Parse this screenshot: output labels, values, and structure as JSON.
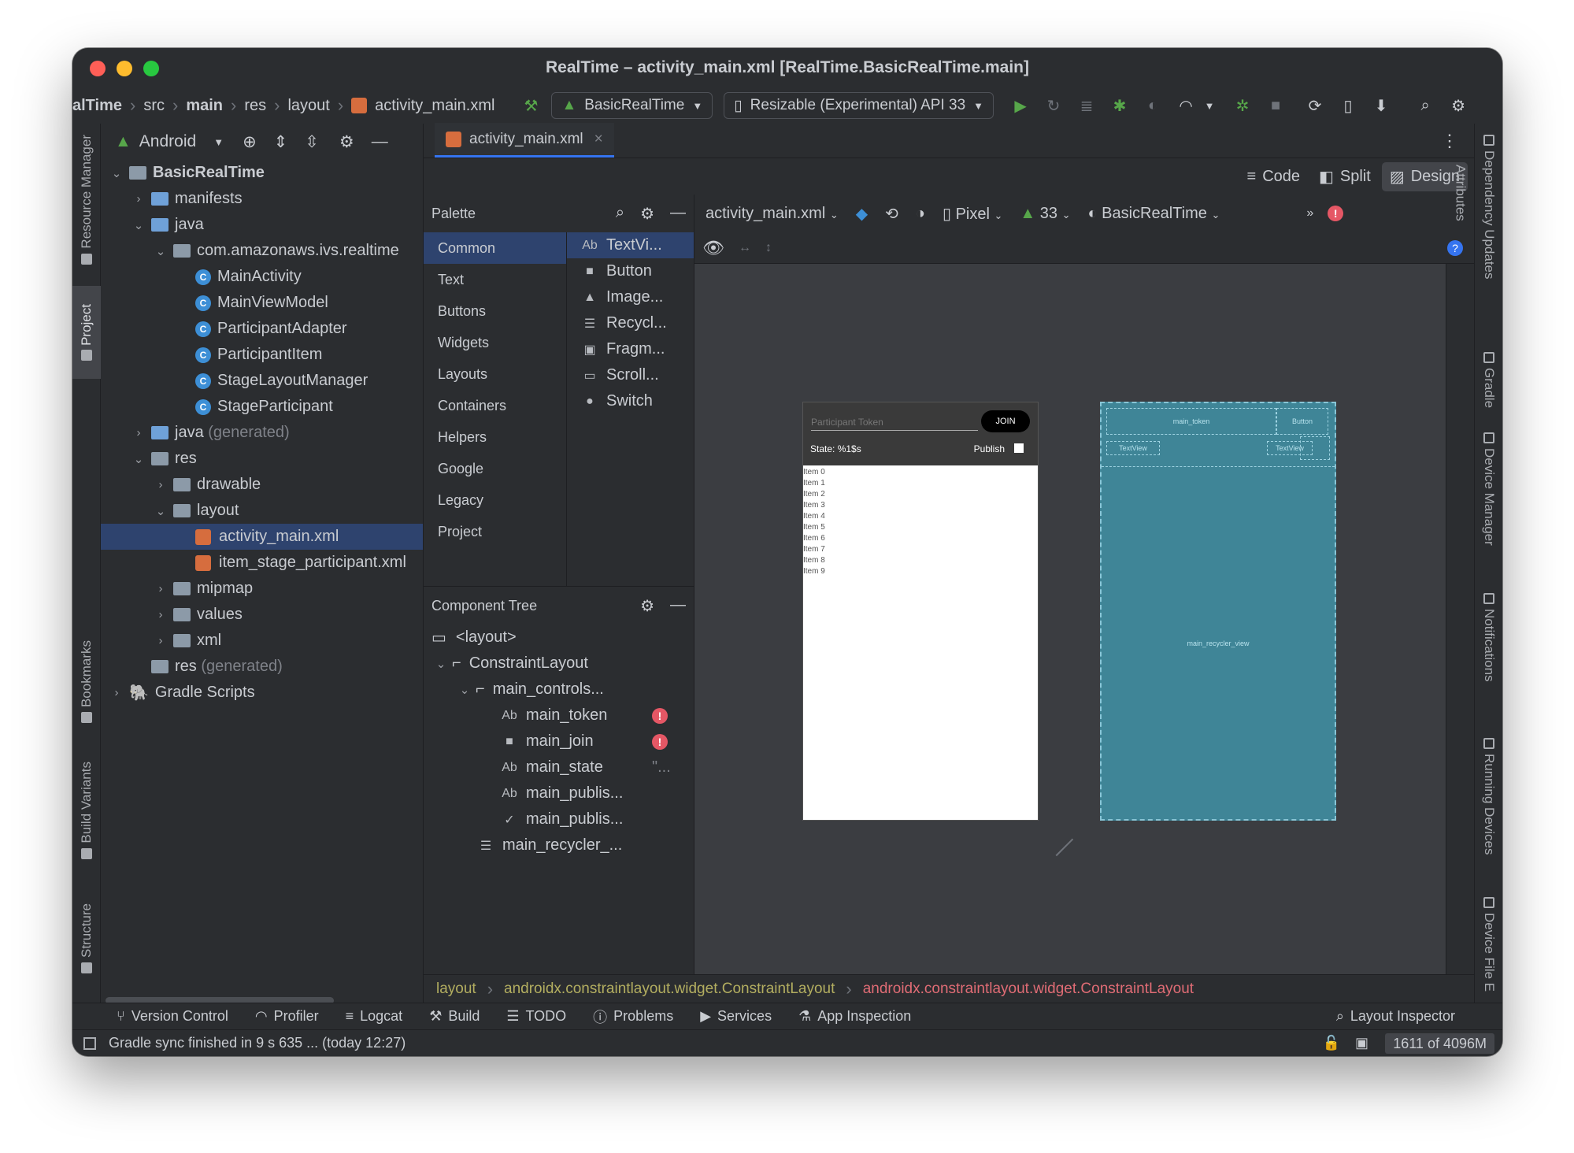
{
  "window": {
    "title": "RealTime – activity_main.xml [RealTime.BasicRealTime.main]"
  },
  "nav": {
    "crumbs": [
      "alTime",
      "src",
      "main",
      "res",
      "layout",
      "activity_main.xml"
    ],
    "run_config": "BasicRealTime",
    "device": "Resizable (Experimental) API 33"
  },
  "project": {
    "view_mode": "Android",
    "tree": [
      {
        "label": "BasicRealTime",
        "bold": true
      },
      {
        "label": "manifests"
      },
      {
        "label": "java"
      },
      {
        "label": "com.amazonaws.ivs.realtime"
      },
      {
        "label": "MainActivity"
      },
      {
        "label": "MainViewModel"
      },
      {
        "label": "ParticipantAdapter"
      },
      {
        "label": "ParticipantItem"
      },
      {
        "label": "StageLayoutManager"
      },
      {
        "label": "StageParticipant"
      },
      {
        "label": "java",
        "suffix": "(generated)"
      },
      {
        "label": "res"
      },
      {
        "label": "drawable"
      },
      {
        "label": "layout"
      },
      {
        "label": "activity_main.xml"
      },
      {
        "label": "item_stage_participant.xml"
      },
      {
        "label": "mipmap"
      },
      {
        "label": "values"
      },
      {
        "label": "xml"
      },
      {
        "label": "res",
        "suffix": "(generated)"
      },
      {
        "label": "Gradle Scripts"
      }
    ]
  },
  "left_strip": {
    "resource_manager": "Resource Manager",
    "project": "Project",
    "bookmarks": "Bookmarks",
    "build_variants": "Build Variants",
    "structure": "Structure"
  },
  "right_strip": {
    "dependency_updates": "Dependency Updates",
    "gradle": "Gradle",
    "device_manager": "Device Manager",
    "notifications": "Notifications",
    "running_devices": "Running Devices",
    "device_file": "Device File E"
  },
  "editor": {
    "tab": "activity_main.xml",
    "modes": {
      "code": "Code",
      "split": "Split",
      "design": "Design"
    },
    "attributes": "Attributes"
  },
  "palette": {
    "title": "Palette",
    "categories": [
      "Common",
      "Text",
      "Buttons",
      "Widgets",
      "Layouts",
      "Containers",
      "Helpers",
      "Google",
      "Legacy",
      "Project"
    ],
    "items": [
      "TextVi...",
      "Button",
      "Image...",
      "Recycl...",
      "Fragm...",
      "Scroll...",
      "Switch"
    ],
    "item_icons": [
      "Ab",
      "■",
      "▲",
      "☰",
      "▣",
      "▭",
      "●"
    ]
  },
  "component_tree": {
    "title": "Component Tree",
    "rows": [
      {
        "label": "<layout>"
      },
      {
        "label": "ConstraintLayout"
      },
      {
        "label": "main_controls..."
      },
      {
        "label": "main_token",
        "icon": "Ab",
        "error": "!"
      },
      {
        "label": "main_join",
        "icon": "■",
        "error": "!"
      },
      {
        "label": "main_state",
        "icon": "Ab",
        "extra": "\"..."
      },
      {
        "label": "main_publis...",
        "icon": "Ab"
      },
      {
        "label": "main_publis...",
        "icon": "✓"
      },
      {
        "label": "main_recycler_...",
        "icon": "☰"
      }
    ]
  },
  "design_toolbar": {
    "file": "activity_main.xml",
    "device": "Pixel",
    "api": "33",
    "theme": "BasicRealTime"
  },
  "preview": {
    "token_hint": "Participant Token",
    "join": "JOIN",
    "state": "State: %1$s",
    "publish": "Publish",
    "items": [
      "Item 0",
      "Item 1",
      "Item 2",
      "Item 3",
      "Item 4",
      "Item 5",
      "Item 6",
      "Item 7",
      "Item 8",
      "Item 9"
    ]
  },
  "blueprint": {
    "main_token": "main_token",
    "button": "Button",
    "textview1": "TextView",
    "textview2": "TextView",
    "recycler": "main_recycler_view"
  },
  "breadcrumb": [
    "layout",
    "androidx.constraintlayout.widget.ConstraintLayout",
    "androidx.constraintlayout.widget.ConstraintLayout"
  ],
  "tool_windows": [
    "Version Control",
    "Profiler",
    "Logcat",
    "Build",
    "TODO",
    "Problems",
    "Services",
    "App Inspection"
  ],
  "layout_inspector": "Layout Inspector",
  "status": {
    "message": "Gradle sync finished in 9 s 635 ... (today 12:27)",
    "memory": "1611 of 4096M"
  },
  "colors": {
    "accent": "#3574f0",
    "selection": "#2e436e",
    "error": "#e55765",
    "blueprint": "#3f8597"
  }
}
